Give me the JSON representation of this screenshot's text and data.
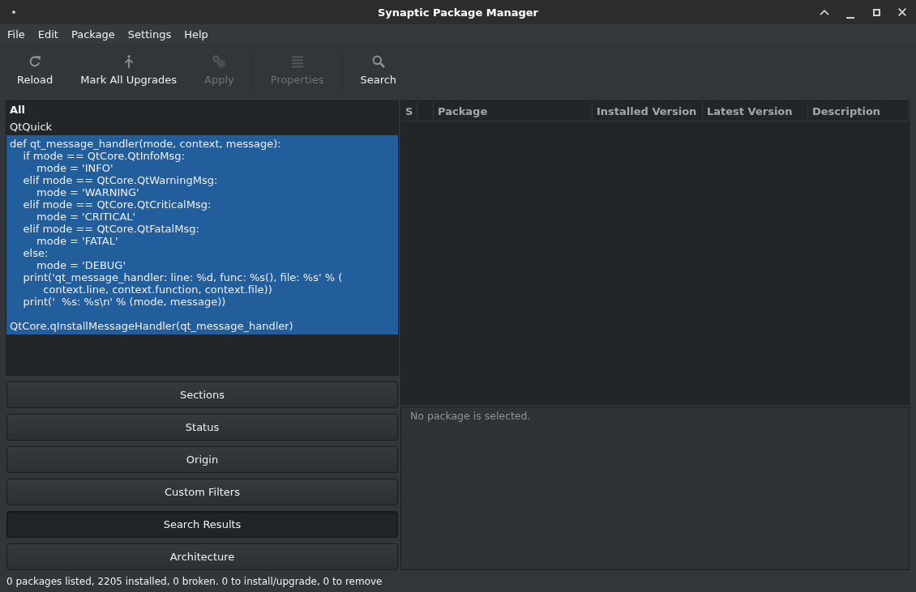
{
  "window": {
    "title": "Synaptic Package Manager"
  },
  "menu": [
    "File",
    "Edit",
    "Package",
    "Settings",
    "Help"
  ],
  "toolbar": [
    {
      "kind": "reload",
      "label": "Reload",
      "disabled": false
    },
    {
      "kind": "upgrade",
      "label": "Mark All Upgrades",
      "disabled": false
    },
    {
      "kind": "apply",
      "label": "Apply",
      "disabled": true
    },
    {
      "kind": "separator"
    },
    {
      "kind": "properties",
      "label": "Properties",
      "disabled": true
    },
    {
      "kind": "separator"
    },
    {
      "kind": "search",
      "label": "Search",
      "disabled": false
    }
  ],
  "filters": {
    "items": [
      {
        "label": "All",
        "bold": true,
        "selected": false
      },
      {
        "label": "QtQuick",
        "bold": false,
        "selected": false
      },
      {
        "label": "def qt_message_handler(mode, context, message):\n    if mode == QtCore.QtInfoMsg:\n        mode = 'INFO'\n    elif mode == QtCore.QtWarningMsg:\n        mode = 'WARNING'\n    elif mode == QtCore.QtCriticalMsg:\n        mode = 'CRITICAL'\n    elif mode == QtCore.QtFatalMsg:\n        mode = 'FATAL'\n    else:\n        mode = 'DEBUG'\n    print('qt_message_handler: line: %d, func: %s(), file: %s' % (\n          context.line, context.function, context.file))\n    print('  %s: %s\\n' % (mode, message))\n\nQtCore.qInstallMessageHandler(qt_message_handler)",
        "bold": false,
        "selected": true
      }
    ]
  },
  "filter_modes": [
    {
      "label": "Sections",
      "selected": false
    },
    {
      "label": "Status",
      "selected": false
    },
    {
      "label": "Origin",
      "selected": false
    },
    {
      "label": "Custom Filters",
      "selected": false
    },
    {
      "label": "Search Results",
      "selected": true
    },
    {
      "label": "Architecture",
      "selected": false
    }
  ],
  "package_table": {
    "columns": [
      {
        "kind": "text",
        "label": "S"
      },
      {
        "kind": "blank"
      },
      {
        "kind": "text",
        "label": "Package"
      },
      {
        "kind": "text",
        "label": "Installed Version"
      },
      {
        "kind": "text",
        "label": "Latest Version"
      },
      {
        "kind": "text",
        "label": "Description"
      }
    ]
  },
  "details": {
    "text": "No package is selected."
  },
  "status_bar": {
    "text": "0 packages listed, 2205 installed, 0 broken. 0 to install/upgrade, 0 to remove"
  }
}
